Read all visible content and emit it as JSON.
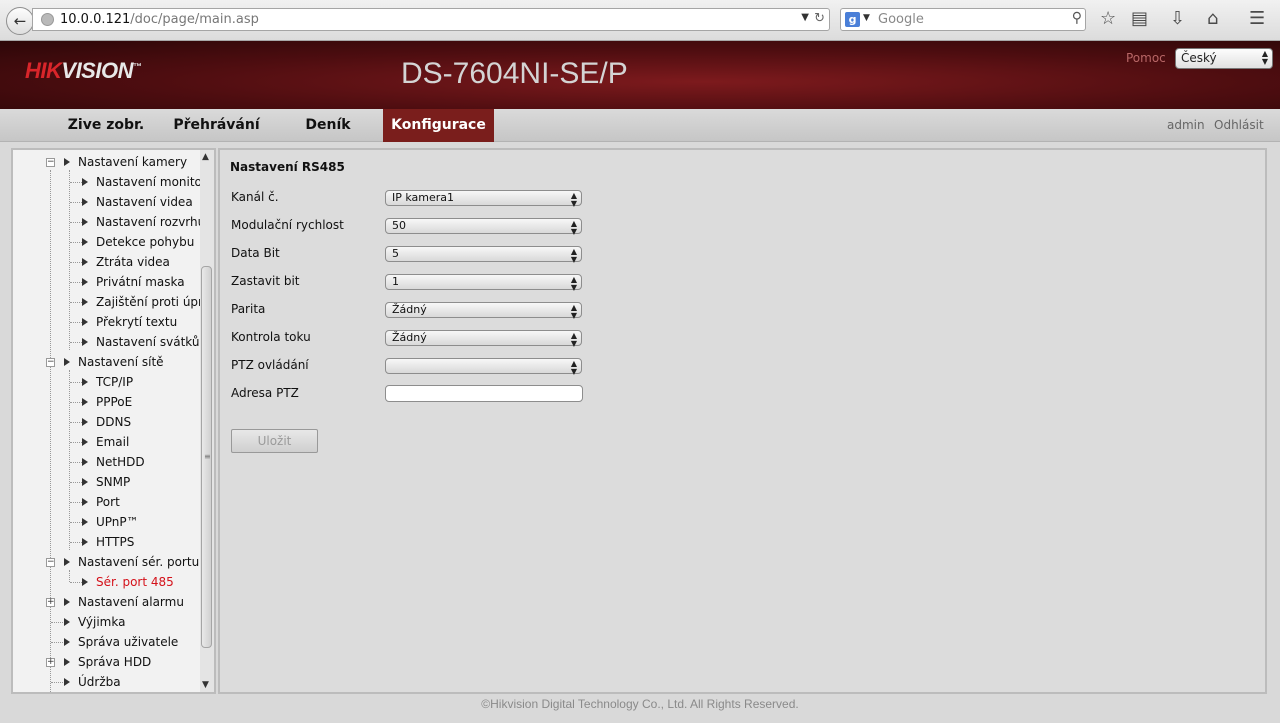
{
  "browser": {
    "url_host": "10.0.0.121",
    "url_path": "/doc/page/main.asp",
    "search_engine_icon": "g",
    "search_placeholder": "Google"
  },
  "header": {
    "logo_red": "HIK",
    "logo_white": "VISION",
    "logo_tm": "™",
    "model": "DS-7604NI-SE/P",
    "help_label": "Pomoc",
    "language_selected": "Český"
  },
  "nav": {
    "tabs": [
      "Zive zobr.",
      "Přehrávání",
      "Deník",
      "Konfigurace"
    ],
    "active_tab": "Konfigurace",
    "user": "admin",
    "logout": "Odhlásit"
  },
  "tree": {
    "items": [
      "Nastavení kamery",
      "Nastavení monitoru",
      "Nastavení videa",
      "Nastavení rozvrhu",
      "Detekce pohybu",
      "Ztráta videa",
      "Privátní maska",
      "Zajištění proti úprav",
      "Překrytí textu",
      "Nastavení svátků",
      "Nastavení sítě",
      "TCP/IP",
      "PPPoE",
      "DDNS",
      "Email",
      "NetHDD",
      "SNMP",
      "Port",
      "UPnP™",
      "HTTPS",
      "Nastavení sér. portu",
      "Sér. port 485",
      "Nastavení alarmu",
      "Výjimka",
      "Správa uživatele",
      "Správa HDD",
      "Údržba"
    ],
    "selected": "Sér. port 485"
  },
  "form": {
    "title": "Nastavení RS485",
    "channel_label": "Kanál č.",
    "channel_value": "IP kamera1",
    "baud_label": "Modulační rychlost",
    "baud_value": "50",
    "databit_label": "Data Bit",
    "databit_value": "5",
    "stopbit_label": "Zastavit bit",
    "stopbit_value": "1",
    "parity_label": "Parita",
    "parity_value": "Žádný",
    "flow_label": "Kontrola toku",
    "flow_value": "Žádný",
    "ptz_protocol_label": "PTZ ovládání",
    "ptz_protocol_value": "",
    "ptz_address_label": "Adresa PTZ",
    "ptz_address_value": "",
    "save_label": "Uložit"
  },
  "footer": {
    "copyright": "©Hikvision Digital Technology Co., Ltd. All Rights Reserved."
  }
}
